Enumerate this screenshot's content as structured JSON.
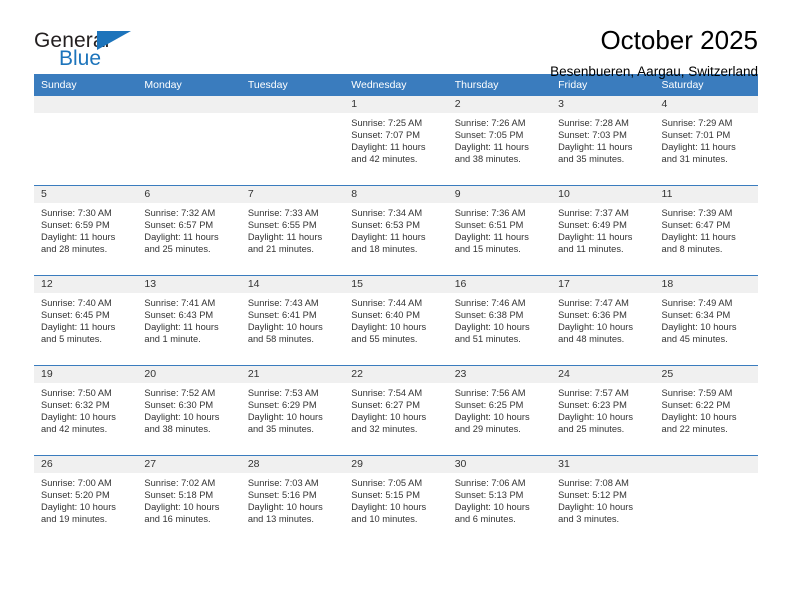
{
  "logo": {
    "word_top": "General",
    "word_bottom": "Blue",
    "triangle_icon": "triangle-icon",
    "accent_color": "#1d74bb"
  },
  "header": {
    "title": "October 2025",
    "subtitle": "Besenbueren, Aargau, Switzerland"
  },
  "theme": {
    "header_row_bg": "#3a7cbe",
    "daynum_bg": "#f0f0f0",
    "text_color": "#333333"
  },
  "calendar": {
    "weekday_headers": [
      "Sunday",
      "Monday",
      "Tuesday",
      "Wednesday",
      "Thursday",
      "Friday",
      "Saturday"
    ],
    "labels": {
      "sunrise": "Sunrise:",
      "sunset": "Sunset:",
      "daylight": "Daylight:"
    },
    "weeks": [
      [
        {
          "day": "",
          "empty": true
        },
        {
          "day": "",
          "empty": true
        },
        {
          "day": "",
          "empty": true
        },
        {
          "day": "1",
          "sunrise": "Sunrise: 7:25 AM",
          "sunset": "Sunset: 7:07 PM",
          "daylight_1": "Daylight: 11 hours",
          "daylight_2": "and 42 minutes."
        },
        {
          "day": "2",
          "sunrise": "Sunrise: 7:26 AM",
          "sunset": "Sunset: 7:05 PM",
          "daylight_1": "Daylight: 11 hours",
          "daylight_2": "and 38 minutes."
        },
        {
          "day": "3",
          "sunrise": "Sunrise: 7:28 AM",
          "sunset": "Sunset: 7:03 PM",
          "daylight_1": "Daylight: 11 hours",
          "daylight_2": "and 35 minutes."
        },
        {
          "day": "4",
          "sunrise": "Sunrise: 7:29 AM",
          "sunset": "Sunset: 7:01 PM",
          "daylight_1": "Daylight: 11 hours",
          "daylight_2": "and 31 minutes."
        }
      ],
      [
        {
          "day": "5",
          "sunrise": "Sunrise: 7:30 AM",
          "sunset": "Sunset: 6:59 PM",
          "daylight_1": "Daylight: 11 hours",
          "daylight_2": "and 28 minutes."
        },
        {
          "day": "6",
          "sunrise": "Sunrise: 7:32 AM",
          "sunset": "Sunset: 6:57 PM",
          "daylight_1": "Daylight: 11 hours",
          "daylight_2": "and 25 minutes."
        },
        {
          "day": "7",
          "sunrise": "Sunrise: 7:33 AM",
          "sunset": "Sunset: 6:55 PM",
          "daylight_1": "Daylight: 11 hours",
          "daylight_2": "and 21 minutes."
        },
        {
          "day": "8",
          "sunrise": "Sunrise: 7:34 AM",
          "sunset": "Sunset: 6:53 PM",
          "daylight_1": "Daylight: 11 hours",
          "daylight_2": "and 18 minutes."
        },
        {
          "day": "9",
          "sunrise": "Sunrise: 7:36 AM",
          "sunset": "Sunset: 6:51 PM",
          "daylight_1": "Daylight: 11 hours",
          "daylight_2": "and 15 minutes."
        },
        {
          "day": "10",
          "sunrise": "Sunrise: 7:37 AM",
          "sunset": "Sunset: 6:49 PM",
          "daylight_1": "Daylight: 11 hours",
          "daylight_2": "and 11 minutes."
        },
        {
          "day": "11",
          "sunrise": "Sunrise: 7:39 AM",
          "sunset": "Sunset: 6:47 PM",
          "daylight_1": "Daylight: 11 hours",
          "daylight_2": "and 8 minutes."
        }
      ],
      [
        {
          "day": "12",
          "sunrise": "Sunrise: 7:40 AM",
          "sunset": "Sunset: 6:45 PM",
          "daylight_1": "Daylight: 11 hours",
          "daylight_2": "and 5 minutes."
        },
        {
          "day": "13",
          "sunrise": "Sunrise: 7:41 AM",
          "sunset": "Sunset: 6:43 PM",
          "daylight_1": "Daylight: 11 hours",
          "daylight_2": "and 1 minute."
        },
        {
          "day": "14",
          "sunrise": "Sunrise: 7:43 AM",
          "sunset": "Sunset: 6:41 PM",
          "daylight_1": "Daylight: 10 hours",
          "daylight_2": "and 58 minutes."
        },
        {
          "day": "15",
          "sunrise": "Sunrise: 7:44 AM",
          "sunset": "Sunset: 6:40 PM",
          "daylight_1": "Daylight: 10 hours",
          "daylight_2": "and 55 minutes."
        },
        {
          "day": "16",
          "sunrise": "Sunrise: 7:46 AM",
          "sunset": "Sunset: 6:38 PM",
          "daylight_1": "Daylight: 10 hours",
          "daylight_2": "and 51 minutes."
        },
        {
          "day": "17",
          "sunrise": "Sunrise: 7:47 AM",
          "sunset": "Sunset: 6:36 PM",
          "daylight_1": "Daylight: 10 hours",
          "daylight_2": "and 48 minutes."
        },
        {
          "day": "18",
          "sunrise": "Sunrise: 7:49 AM",
          "sunset": "Sunset: 6:34 PM",
          "daylight_1": "Daylight: 10 hours",
          "daylight_2": "and 45 minutes."
        }
      ],
      [
        {
          "day": "19",
          "sunrise": "Sunrise: 7:50 AM",
          "sunset": "Sunset: 6:32 PM",
          "daylight_1": "Daylight: 10 hours",
          "daylight_2": "and 42 minutes."
        },
        {
          "day": "20",
          "sunrise": "Sunrise: 7:52 AM",
          "sunset": "Sunset: 6:30 PM",
          "daylight_1": "Daylight: 10 hours",
          "daylight_2": "and 38 minutes."
        },
        {
          "day": "21",
          "sunrise": "Sunrise: 7:53 AM",
          "sunset": "Sunset: 6:29 PM",
          "daylight_1": "Daylight: 10 hours",
          "daylight_2": "and 35 minutes."
        },
        {
          "day": "22",
          "sunrise": "Sunrise: 7:54 AM",
          "sunset": "Sunset: 6:27 PM",
          "daylight_1": "Daylight: 10 hours",
          "daylight_2": "and 32 minutes."
        },
        {
          "day": "23",
          "sunrise": "Sunrise: 7:56 AM",
          "sunset": "Sunset: 6:25 PM",
          "daylight_1": "Daylight: 10 hours",
          "daylight_2": "and 29 minutes."
        },
        {
          "day": "24",
          "sunrise": "Sunrise: 7:57 AM",
          "sunset": "Sunset: 6:23 PM",
          "daylight_1": "Daylight: 10 hours",
          "daylight_2": "and 25 minutes."
        },
        {
          "day": "25",
          "sunrise": "Sunrise: 7:59 AM",
          "sunset": "Sunset: 6:22 PM",
          "daylight_1": "Daylight: 10 hours",
          "daylight_2": "and 22 minutes."
        }
      ],
      [
        {
          "day": "26",
          "sunrise": "Sunrise: 7:00 AM",
          "sunset": "Sunset: 5:20 PM",
          "daylight_1": "Daylight: 10 hours",
          "daylight_2": "and 19 minutes."
        },
        {
          "day": "27",
          "sunrise": "Sunrise: 7:02 AM",
          "sunset": "Sunset: 5:18 PM",
          "daylight_1": "Daylight: 10 hours",
          "daylight_2": "and 16 minutes."
        },
        {
          "day": "28",
          "sunrise": "Sunrise: 7:03 AM",
          "sunset": "Sunset: 5:16 PM",
          "daylight_1": "Daylight: 10 hours",
          "daylight_2": "and 13 minutes."
        },
        {
          "day": "29",
          "sunrise": "Sunrise: 7:05 AM",
          "sunset": "Sunset: 5:15 PM",
          "daylight_1": "Daylight: 10 hours",
          "daylight_2": "and 10 minutes."
        },
        {
          "day": "30",
          "sunrise": "Sunrise: 7:06 AM",
          "sunset": "Sunset: 5:13 PM",
          "daylight_1": "Daylight: 10 hours",
          "daylight_2": "and 6 minutes."
        },
        {
          "day": "31",
          "sunrise": "Sunrise: 7:08 AM",
          "sunset": "Sunset: 5:12 PM",
          "daylight_1": "Daylight: 10 hours",
          "daylight_2": "and 3 minutes."
        },
        {
          "day": "",
          "empty": true
        }
      ]
    ]
  }
}
